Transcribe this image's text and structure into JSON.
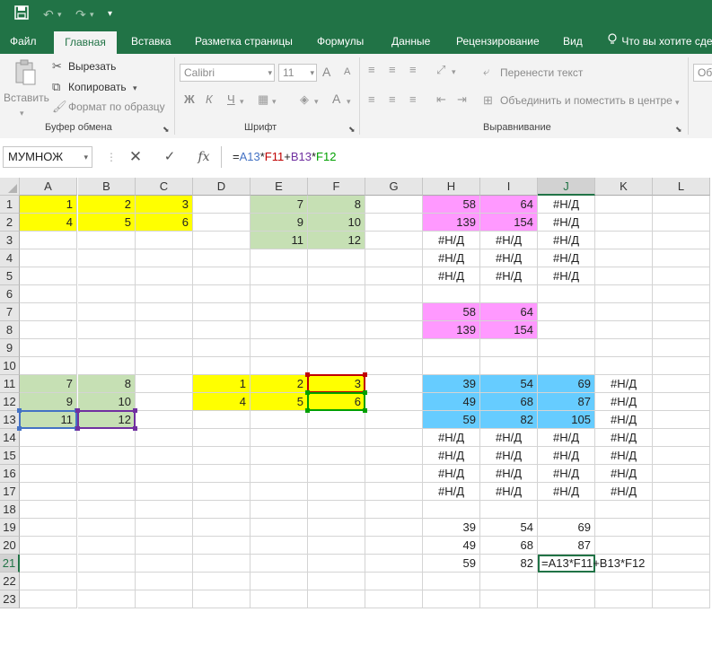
{
  "colors": {
    "excel_green": "#217346",
    "yellow": "#ffff00",
    "light_green": "#c6e0b4",
    "pink": "#ff99ff",
    "blue": "#66ccff",
    "ref_blue": "#4472c4",
    "ref_red": "#c00000",
    "ref_purple": "#7030a0",
    "ref_green": "#00a000"
  },
  "qat": {
    "save_icon": "save-icon",
    "undo_icon": "undo-icon",
    "redo_icon": "redo-icon",
    "customize_icon": "customize-qat-icon"
  },
  "tabs": [
    {
      "label": "Файл",
      "active": false
    },
    {
      "label": "Главная",
      "active": true
    },
    {
      "label": "Вставка",
      "active": false
    },
    {
      "label": "Разметка страницы",
      "active": false
    },
    {
      "label": "Формулы",
      "active": false
    },
    {
      "label": "Данные",
      "active": false
    },
    {
      "label": "Рецензирование",
      "active": false
    },
    {
      "label": "Вид",
      "active": false
    }
  ],
  "tellme": {
    "placeholder": "Что вы хотите сделать?",
    "icon": "lightbulb-icon"
  },
  "ribbon": {
    "clipboard": {
      "label": "Буфер обмена",
      "paste": "Вставить",
      "cut": "Вырезать",
      "copy": "Копировать",
      "format_painter": "Формат по образцу"
    },
    "font": {
      "label": "Шрифт",
      "font_name": "Calibri",
      "font_size": "11",
      "bold": "Ж",
      "italic": "К",
      "underline": "Ч",
      "grow": "A",
      "shrink": "A"
    },
    "alignment": {
      "label": "Выравнивание",
      "wrap_text": "Перенести текст",
      "merge_center": "Объединить и поместить в центре"
    },
    "number": {
      "format": "Об"
    }
  },
  "formula_bar": {
    "name_box": "МУМНОЖ",
    "cancel_icon": "cancel-icon",
    "enter_icon": "check-icon",
    "fx_label": "fx",
    "formula_parts": [
      {
        "text": "=",
        "color": "#222222"
      },
      {
        "text": "A13",
        "color": "#4472c4"
      },
      {
        "text": "*",
        "color": "#222222"
      },
      {
        "text": "F11",
        "color": "#c00000"
      },
      {
        "text": "+",
        "color": "#222222"
      },
      {
        "text": "B13",
        "color": "#7030a0"
      },
      {
        "text": "*",
        "color": "#222222"
      },
      {
        "text": "F12",
        "color": "#00a000"
      }
    ]
  },
  "sheet": {
    "columns": [
      "A",
      "B",
      "C",
      "D",
      "E",
      "F",
      "G",
      "H",
      "I",
      "J",
      "K",
      "L"
    ],
    "selected_column": "J",
    "selected_row": 21,
    "rows": [
      1,
      2,
      3,
      4,
      5,
      6,
      7,
      8,
      9,
      10,
      11,
      12,
      13,
      14,
      15,
      16,
      17,
      18,
      19,
      20,
      21,
      22,
      23
    ],
    "cells": [
      {
        "ref": "A1",
        "v": "1",
        "bg": "yellow"
      },
      {
        "ref": "B1",
        "v": "2",
        "bg": "yellow"
      },
      {
        "ref": "C1",
        "v": "3",
        "bg": "yellow"
      },
      {
        "ref": "A2",
        "v": "4",
        "bg": "yellow"
      },
      {
        "ref": "B2",
        "v": "5",
        "bg": "yellow"
      },
      {
        "ref": "C2",
        "v": "6",
        "bg": "yellow"
      },
      {
        "ref": "E1",
        "v": "7",
        "bg": "light_green"
      },
      {
        "ref": "F1",
        "v": "8",
        "bg": "light_green"
      },
      {
        "ref": "E2",
        "v": "9",
        "bg": "light_green"
      },
      {
        "ref": "F2",
        "v": "10",
        "bg": "light_green"
      },
      {
        "ref": "E3",
        "v": "11",
        "bg": "light_green"
      },
      {
        "ref": "F3",
        "v": "12",
        "bg": "light_green"
      },
      {
        "ref": "H1",
        "v": "58",
        "bg": "pink"
      },
      {
        "ref": "I1",
        "v": "64",
        "bg": "pink"
      },
      {
        "ref": "J1",
        "v": "#Н/Д"
      },
      {
        "ref": "H2",
        "v": "139",
        "bg": "pink"
      },
      {
        "ref": "I2",
        "v": "154",
        "bg": "pink"
      },
      {
        "ref": "J2",
        "v": "#Н/Д"
      },
      {
        "ref": "H3",
        "v": "#Н/Д"
      },
      {
        "ref": "I3",
        "v": "#Н/Д"
      },
      {
        "ref": "J3",
        "v": "#Н/Д"
      },
      {
        "ref": "H4",
        "v": "#Н/Д"
      },
      {
        "ref": "I4",
        "v": "#Н/Д"
      },
      {
        "ref": "J4",
        "v": "#Н/Д"
      },
      {
        "ref": "H5",
        "v": "#Н/Д"
      },
      {
        "ref": "I5",
        "v": "#Н/Д"
      },
      {
        "ref": "J5",
        "v": "#Н/Д"
      },
      {
        "ref": "H7",
        "v": "58",
        "bg": "pink"
      },
      {
        "ref": "I7",
        "v": "64",
        "bg": "pink"
      },
      {
        "ref": "H8",
        "v": "139",
        "bg": "pink"
      },
      {
        "ref": "I8",
        "v": "154",
        "bg": "pink"
      },
      {
        "ref": "A11",
        "v": "7",
        "bg": "light_green"
      },
      {
        "ref": "B11",
        "v": "8",
        "bg": "light_green"
      },
      {
        "ref": "A12",
        "v": "9",
        "bg": "light_green"
      },
      {
        "ref": "B12",
        "v": "10",
        "bg": "light_green"
      },
      {
        "ref": "A13",
        "v": "11",
        "bg": "light_green"
      },
      {
        "ref": "B13",
        "v": "12",
        "bg": "light_green"
      },
      {
        "ref": "D11",
        "v": "1",
        "bg": "yellow"
      },
      {
        "ref": "E11",
        "v": "2",
        "bg": "yellow"
      },
      {
        "ref": "F11",
        "v": "3",
        "bg": "yellow"
      },
      {
        "ref": "D12",
        "v": "4",
        "bg": "yellow"
      },
      {
        "ref": "E12",
        "v": "5",
        "bg": "yellow"
      },
      {
        "ref": "F12",
        "v": "6",
        "bg": "yellow"
      },
      {
        "ref": "H11",
        "v": "39",
        "bg": "blue"
      },
      {
        "ref": "I11",
        "v": "54",
        "bg": "blue"
      },
      {
        "ref": "J11",
        "v": "69",
        "bg": "blue"
      },
      {
        "ref": "K11",
        "v": "#Н/Д"
      },
      {
        "ref": "H12",
        "v": "49",
        "bg": "blue"
      },
      {
        "ref": "I12",
        "v": "68",
        "bg": "blue"
      },
      {
        "ref": "J12",
        "v": "87",
        "bg": "blue"
      },
      {
        "ref": "K12",
        "v": "#Н/Д"
      },
      {
        "ref": "H13",
        "v": "59",
        "bg": "blue"
      },
      {
        "ref": "I13",
        "v": "82",
        "bg": "blue"
      },
      {
        "ref": "J13",
        "v": "105",
        "bg": "blue"
      },
      {
        "ref": "K13",
        "v": "#Н/Д"
      },
      {
        "ref": "H14",
        "v": "#Н/Д"
      },
      {
        "ref": "I14",
        "v": "#Н/Д"
      },
      {
        "ref": "J14",
        "v": "#Н/Д"
      },
      {
        "ref": "K14",
        "v": "#Н/Д"
      },
      {
        "ref": "H15",
        "v": "#Н/Д"
      },
      {
        "ref": "I15",
        "v": "#Н/Д"
      },
      {
        "ref": "J15",
        "v": "#Н/Д"
      },
      {
        "ref": "K15",
        "v": "#Н/Д"
      },
      {
        "ref": "H16",
        "v": "#Н/Д"
      },
      {
        "ref": "I16",
        "v": "#Н/Д"
      },
      {
        "ref": "J16",
        "v": "#Н/Д"
      },
      {
        "ref": "K16",
        "v": "#Н/Д"
      },
      {
        "ref": "H17",
        "v": "#Н/Д"
      },
      {
        "ref": "I17",
        "v": "#Н/Д"
      },
      {
        "ref": "J17",
        "v": "#Н/Д"
      },
      {
        "ref": "K17",
        "v": "#Н/Д"
      },
      {
        "ref": "H19",
        "v": "39"
      },
      {
        "ref": "I19",
        "v": "54"
      },
      {
        "ref": "J19",
        "v": "69"
      },
      {
        "ref": "H20",
        "v": "49"
      },
      {
        "ref": "I20",
        "v": "68"
      },
      {
        "ref": "J20",
        "v": "87"
      },
      {
        "ref": "H21",
        "v": "59"
      },
      {
        "ref": "I21",
        "v": "82"
      }
    ],
    "editing_cell": {
      "ref": "J21",
      "text": "=A13*F11+B13*F12"
    },
    "ref_ranges": [
      {
        "from": "A13",
        "to": "A13",
        "color": "ref_blue"
      },
      {
        "from": "F11",
        "to": "F11",
        "color": "ref_red"
      },
      {
        "from": "B13",
        "to": "B13",
        "color": "ref_purple"
      },
      {
        "from": "F12",
        "to": "F12",
        "color": "ref_green"
      }
    ]
  }
}
